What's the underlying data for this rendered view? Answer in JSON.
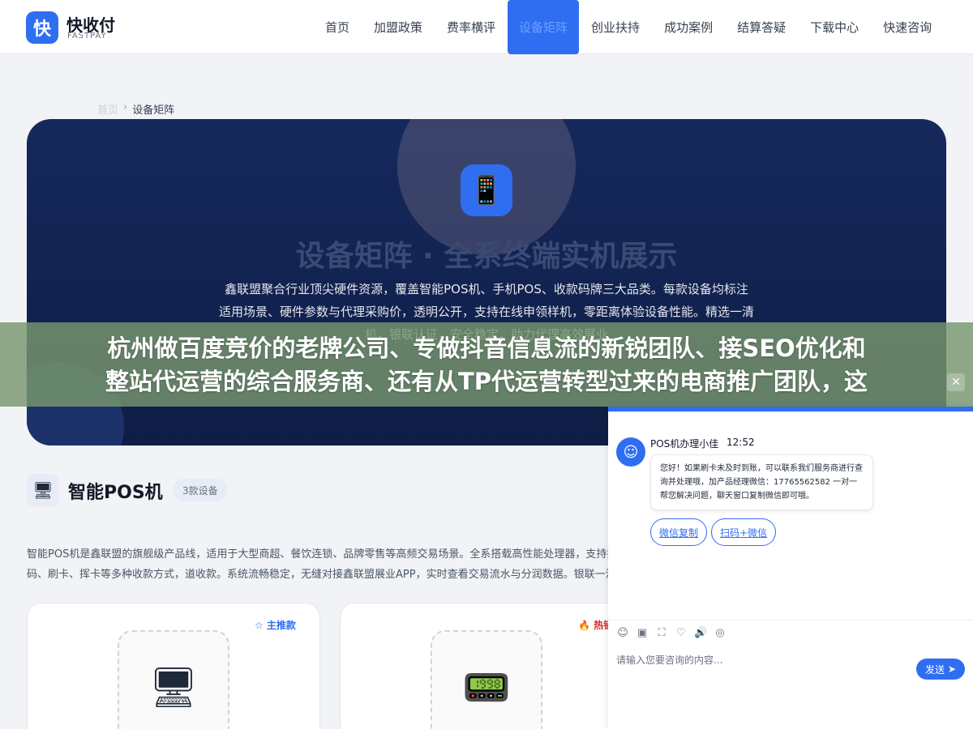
{
  "header": {
    "logo_char": "快",
    "logo_name": "快收付",
    "logo_sub": "FASTPAY",
    "nav": [
      {
        "label": "首页"
      },
      {
        "label": "加盟政策"
      },
      {
        "label": "费率横评"
      },
      {
        "label": "设备矩阵",
        "active": true
      },
      {
        "label": "创业扶持"
      },
      {
        "label": "成功案例"
      },
      {
        "label": "结算答疑"
      },
      {
        "label": "下载中心"
      },
      {
        "label": "快速咨询"
      }
    ]
  },
  "breadcrumb": {
    "home": "首页",
    "sep": "›",
    "current": "设备矩阵"
  },
  "hero": {
    "icon": "📱",
    "title": "设备矩阵 · 全系终端实机展示",
    "desc": "鑫联盟聚合行业顶尖硬件资源，覆盖智能POS机、手机POS、收款码牌三大品类。每款设备均标注适用场景、硬件参数与代理采购价，透明公开，支持在线申领样机，零距离体验设备性能。精选一清机，银联认证，安全稳定，助力代理高效展业"
  },
  "banner": {
    "line1": "杭州做百度竞价的老牌公司、专做抖音信息流的新锐团队、接SEO优化和",
    "line2": "整站代运营的综合服务商、还有从TP代运营转型过来的电商推广团队，这",
    "close": "✕"
  },
  "section": {
    "icon": "🖥",
    "title": "智能POS机",
    "badge": "3款设备",
    "desc": "智能POS机是鑫联盟的旗舰级产品线，适用于大型商超、餐饮连锁、品牌零售等高频交易场景。全系搭载高性能处理器，支持扫码、刷卡、挥卡等多种收款方式，道收款。系统流畅稳定，无缝对接鑫联盟展业APP，实时查看交易流水与分润数据。银联一清机认证，资金安全有保障"
  },
  "cards": [
    {
      "tag": "☆ 主推款",
      "tag_color": "#2f6ef0",
      "img": "🖥"
    },
    {
      "tag": "🔥 热销",
      "tag_color": "#dc2626",
      "img": "📟"
    }
  ],
  "chat": {
    "avatar": "☺",
    "agent": "POS机办理小佳",
    "time": "12:52",
    "message": "您好！如果刷卡未及时到账，可以联系我们服务商进行查询并处理哦，加产品经理微信：17765562582 一对一帮您解决问题，聊天窗口复制微信即可哦。",
    "btn_copy": "微信复制",
    "btn_scan": "扫码+微信",
    "tools": [
      "☺",
      "▣",
      "⛶",
      "♡",
      "🔊",
      "◎"
    ],
    "placeholder": "请输入您要咨询的内容...",
    "send": "发送",
    "send_icon": "➤"
  },
  "colors": {
    "brand": "#2f6ef0",
    "hero_bg": "#16295c"
  }
}
